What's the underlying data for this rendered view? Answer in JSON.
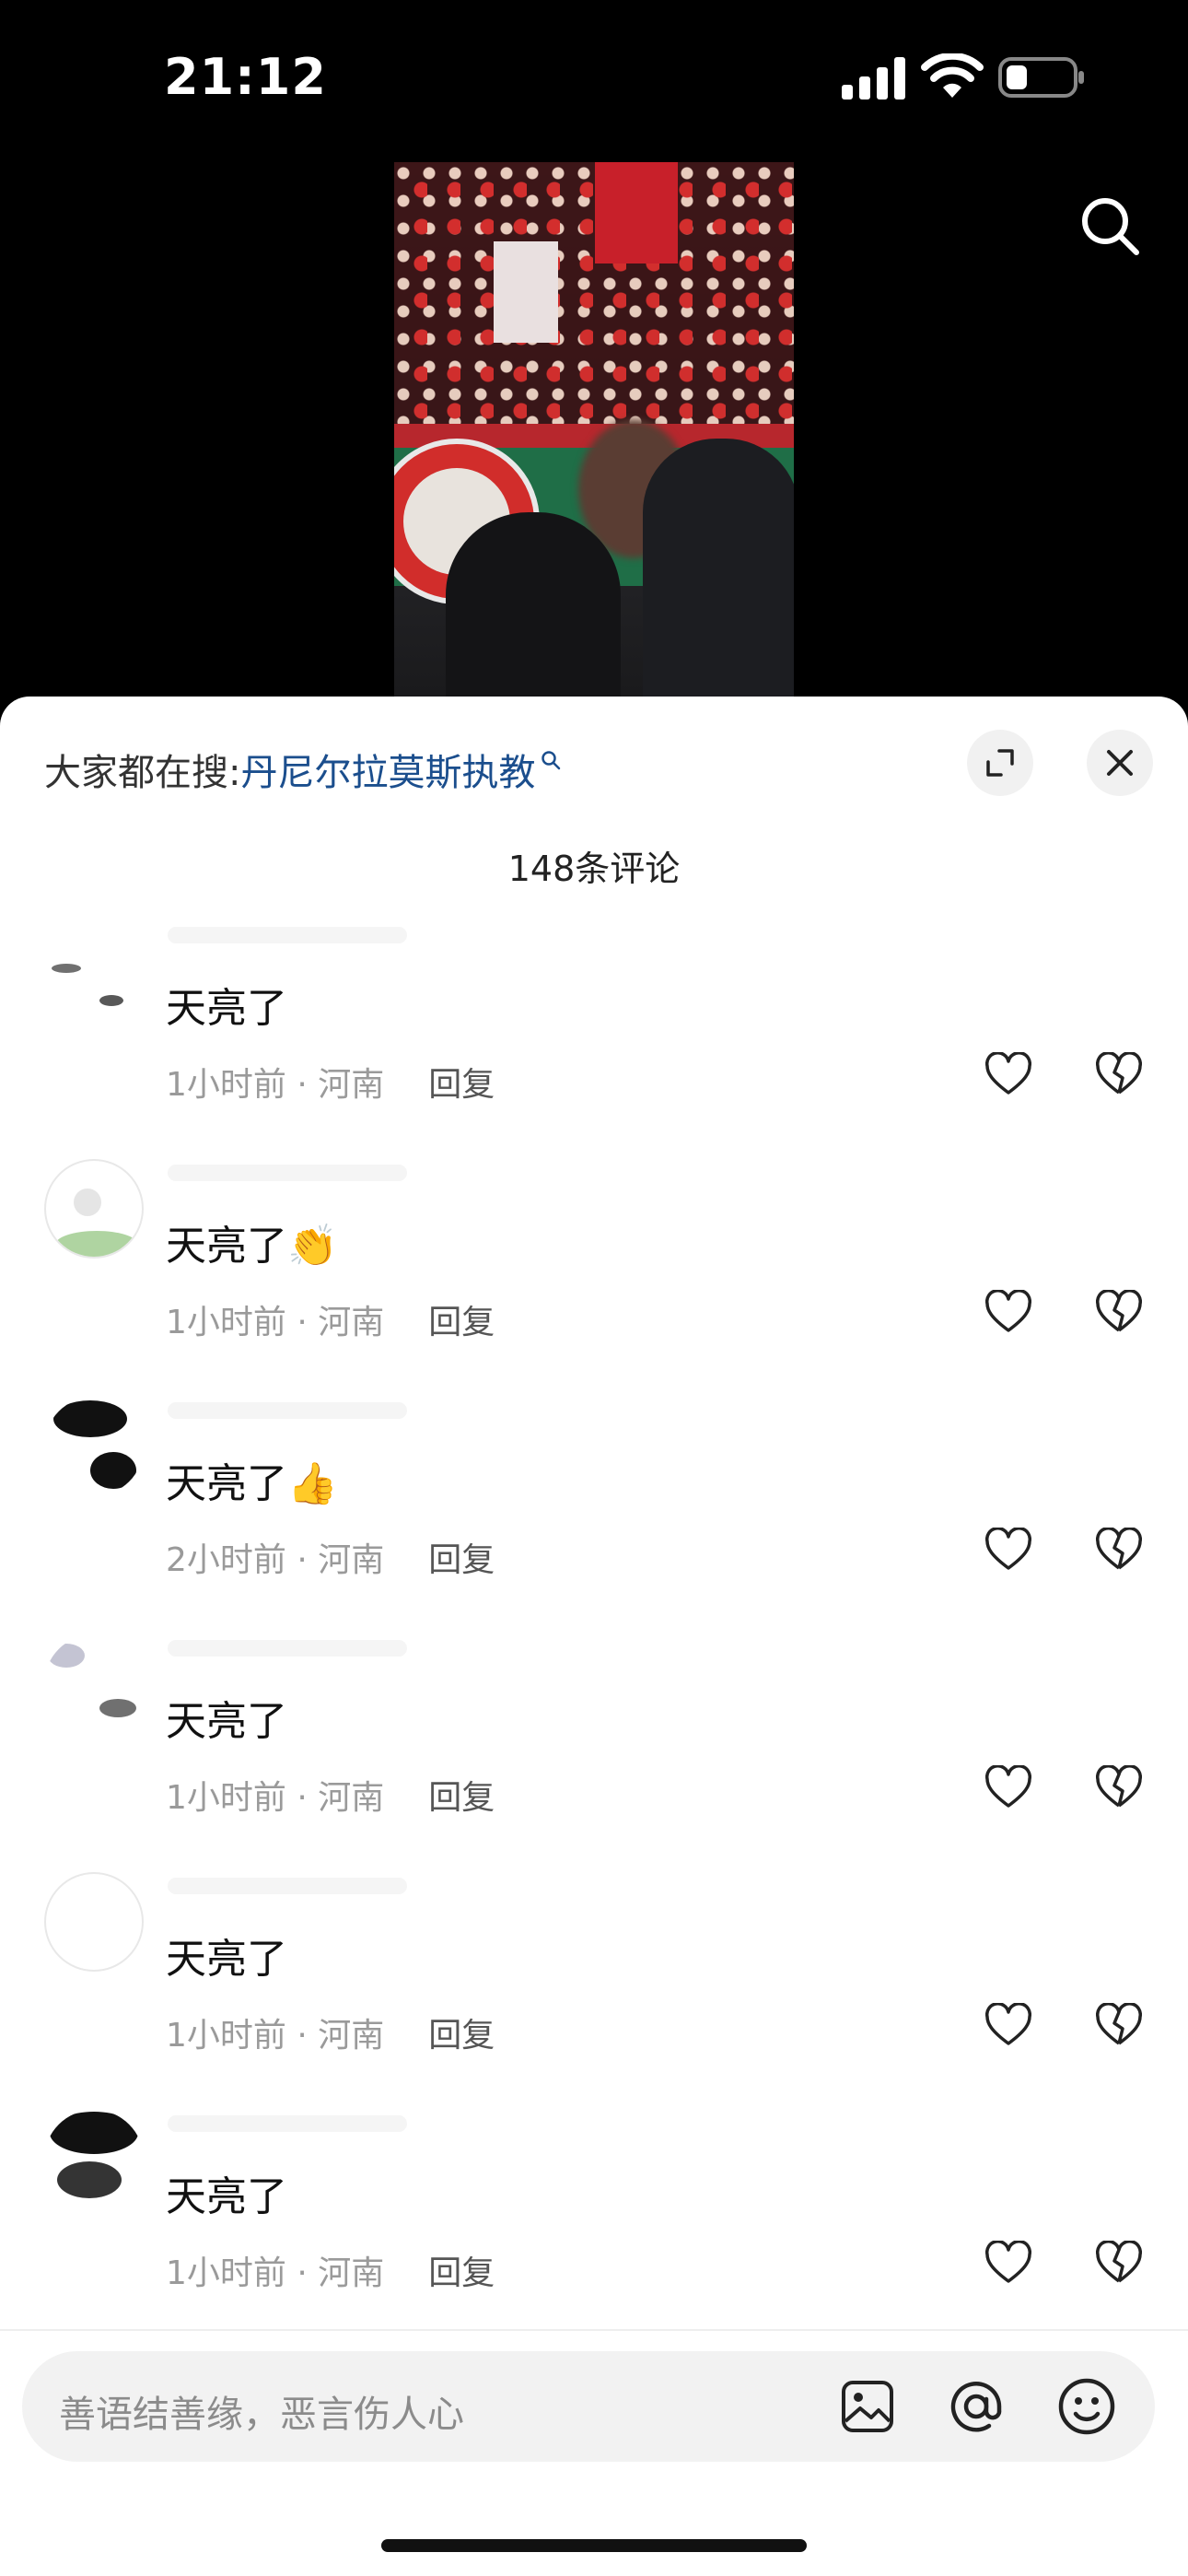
{
  "status_bar": {
    "time": "21:12"
  },
  "sheet": {
    "trending_prefix": "大家都在搜:",
    "trending_query": "丹尼尔拉莫斯执教",
    "comment_count": "148条评论"
  },
  "comments": [
    {
      "text": "天亮了",
      "emoji": "",
      "time": "1小时前",
      "location": "河南",
      "reply": "回复"
    },
    {
      "text": "天亮了",
      "emoji": "👏",
      "time": "1小时前",
      "location": "河南",
      "reply": "回复"
    },
    {
      "text": "天亮了",
      "emoji": "👍",
      "time": "2小时前",
      "location": "河南",
      "reply": "回复"
    },
    {
      "text": "天亮了",
      "emoji": "",
      "time": "1小时前",
      "location": "河南",
      "reply": "回复"
    },
    {
      "text": "天亮了",
      "emoji": "",
      "time": "1小时前",
      "location": "河南",
      "reply": "回复"
    },
    {
      "text": "天亮了",
      "emoji": "",
      "time": "1小时前",
      "location": "河南",
      "reply": "回复"
    }
  ],
  "input": {
    "placeholder": "善语结善缘，恶言伤人心"
  },
  "icons": {
    "search": "search-icon",
    "expand": "expand-icon",
    "close": "close-icon",
    "like": "heart-icon",
    "dislike": "broken-heart-icon",
    "image": "image-icon",
    "mention": "at-icon",
    "emoji": "emoji-icon"
  },
  "colors": {
    "link": "#1b4e8d",
    "meta": "#9a9a9a",
    "sheet_bg": "#ffffff"
  }
}
